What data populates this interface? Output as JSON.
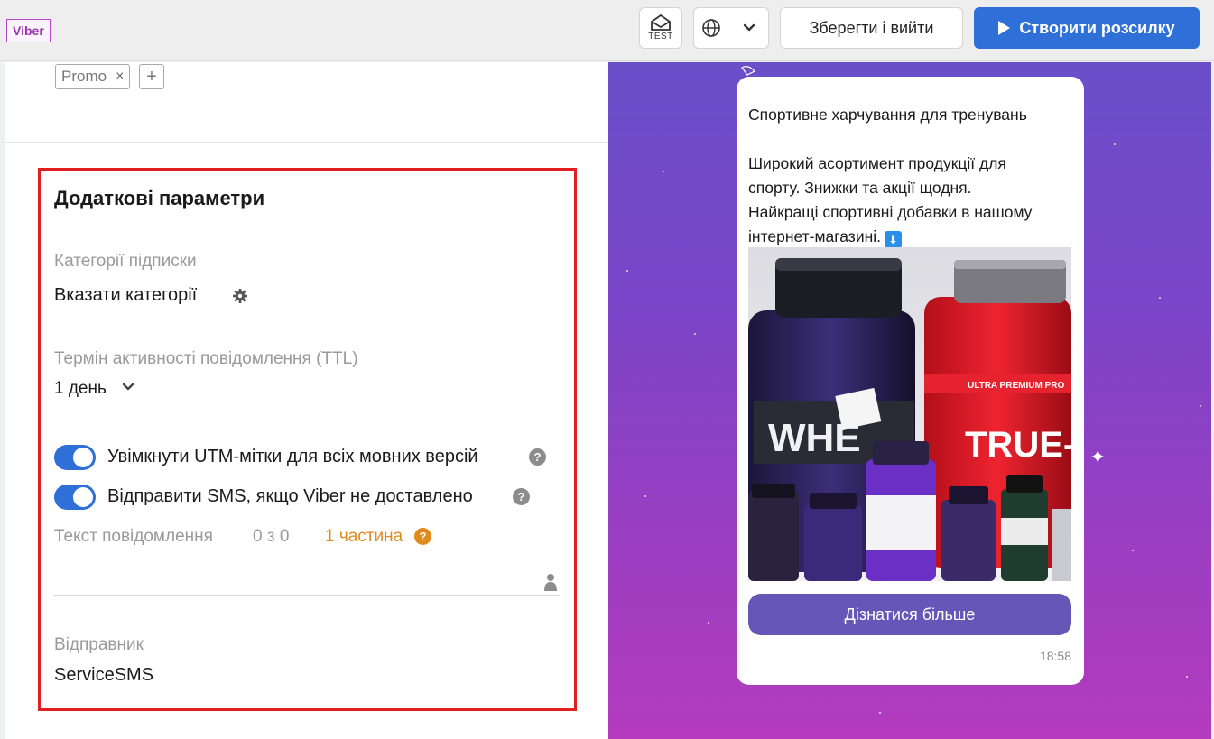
{
  "header": {
    "channel": "Viber",
    "test_label": "TEST",
    "save_exit_label": "Зберегти і вийти",
    "create_label": "Створити розсилку"
  },
  "tags": {
    "items": [
      {
        "label": "Promo"
      }
    ],
    "remove_glyph": "×",
    "add_glyph": "+"
  },
  "additional": {
    "title": "Додаткові параметри",
    "subscription_label": "Категорії підписки",
    "subscription_value": "Вказати категорії",
    "ttl_label": "Термін активності повідомлення (TTL)",
    "ttl_value": "1 день",
    "utm_toggle": {
      "label": "Увімкнути UTM-мітки для всіх мовних версій",
      "on": true
    },
    "sms_toggle": {
      "label": "Відправити SMS, якщо Viber не доставлено",
      "on": true
    },
    "sms_text_label": "Текст повідомлення",
    "sms_counter": "0  з 0",
    "sms_parts": "1 частина",
    "sender_label": "Відправник",
    "sender_value": "ServiceSMS"
  },
  "preview": {
    "message_lines": [
      "Спортивне харчування для тренувань",
      "",
      "Широкий асортимент продукції для",
      "спорту. Знижки та акції щодня.",
      "Найкращі спортивні добавки в нашому",
      "інтернет-магазині."
    ],
    "arrow_glyph": "⬇",
    "image_labels": {
      "left_jar": "WHE",
      "right_jar": "TRUE-",
      "right_jar_band": "ULTRA PREMIUM PRO"
    },
    "button_label": "Дізнатися більше",
    "time": "18:58"
  },
  "colors": {
    "primary": "#2f6fd8",
    "highlight_border": "#e02020",
    "warning": "#e08a1e",
    "cta": "#6656b8"
  },
  "icons": [
    "envelope-icon",
    "globe-icon",
    "chevron-down-icon",
    "play-icon",
    "gear-icon",
    "help-icon",
    "person-icon",
    "sparkle-icon"
  ]
}
